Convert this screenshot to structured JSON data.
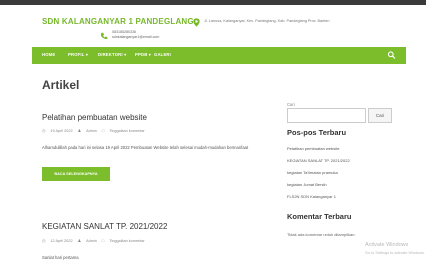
{
  "header": {
    "site_title": "SDN KALANGANYAR 1 PANDEGLANG",
    "phone": "083185280336",
    "email": "sdnkalanganyar1@email.com",
    "address": "Jl. Lanusa, Kalanganyar, Kec. Pandeglang, Kab. Pandeglang Prov. Banten"
  },
  "nav": {
    "items": [
      "HOME",
      "PROFIL ▾",
      "DIREKTORI ▾",
      "PPDB ▾",
      "GALERI"
    ],
    "search_icon": "search-icon"
  },
  "main": {
    "page_title": "Artikel",
    "posts": [
      {
        "title": "Pelatihan pembuatan website",
        "date": "19 April 2022",
        "author": "Admin",
        "comments": "Tinggalkan komentar",
        "excerpt": "Alhamdulillah pada hari ini selasa 19 April 2022 Pembuatan Website telah selesai mudah-mudahan bermanfaat",
        "read_more": "BACA SELENGKAPNYA"
      },
      {
        "title": "KEGIATAN SANLAT TP. 2021/2022",
        "date": "12 April 2022",
        "author": "Admin",
        "comments": "Tinggalkan komentar",
        "excerpt": "Sanlat hari pertama"
      }
    ]
  },
  "sidebar": {
    "search_label": "Cari",
    "search_button": "Cari",
    "recent_posts_title": "Pos-pos Terbaru",
    "recent_posts": [
      "Pelatihan pembuatan website",
      "KEGIATAN SANLAT TP. 2021/2022",
      "kegiatan Ta'limatan pramuka",
      "kegiatan Jumat Bersih",
      "FLS2N SDN Kalanganyar 1"
    ],
    "recent_comments_title": "Komentar Terbaru",
    "recent_comments_text": "Tidak ada komentar untuk ditampilkan."
  },
  "os_watermark": {
    "line1": "Activate Windows",
    "line2": "Go to Settings to activate Windows."
  },
  "colors": {
    "accent": "#7bbd2a",
    "title_green": "#76b82a",
    "topbar": "#3a3a3a"
  }
}
